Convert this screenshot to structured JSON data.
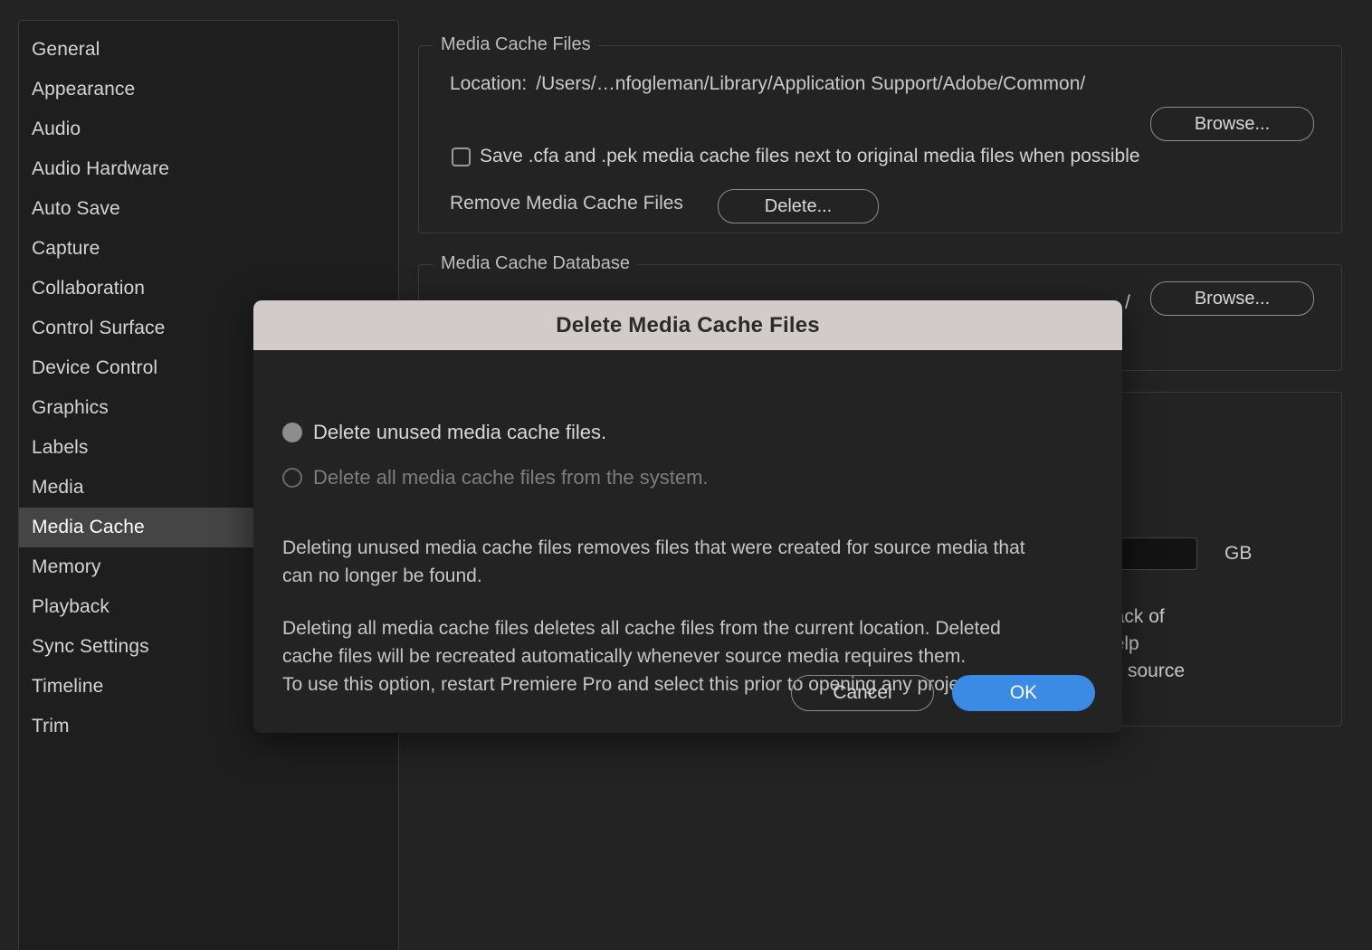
{
  "sidebar": {
    "items": [
      {
        "label": "General",
        "selected": false
      },
      {
        "label": "Appearance",
        "selected": false
      },
      {
        "label": "Audio",
        "selected": false
      },
      {
        "label": "Audio Hardware",
        "selected": false
      },
      {
        "label": "Auto Save",
        "selected": false
      },
      {
        "label": "Capture",
        "selected": false
      },
      {
        "label": "Collaboration",
        "selected": false
      },
      {
        "label": "Control Surface",
        "selected": false
      },
      {
        "label": "Device Control",
        "selected": false
      },
      {
        "label": "Graphics",
        "selected": false
      },
      {
        "label": "Labels",
        "selected": false
      },
      {
        "label": "Media",
        "selected": false
      },
      {
        "label": "Media Cache",
        "selected": true
      },
      {
        "label": "Memory",
        "selected": false
      },
      {
        "label": "Playback",
        "selected": false
      },
      {
        "label": "Sync Settings",
        "selected": false
      },
      {
        "label": "Timeline",
        "selected": false
      },
      {
        "label": "Trim",
        "selected": false
      }
    ]
  },
  "media_cache_files": {
    "group_title": "Media Cache Files",
    "location_label": "Location:",
    "location_path": "/Users/…nfogleman/Library/Application Support/Adobe/Common/",
    "browse_label": "Browse...",
    "save_checkbox_label": "Save .cfa and .pek media cache files next to original media files when possible",
    "save_checkbox_checked": false,
    "remove_label": "Remove Media Cache Files",
    "delete_label": "Delete..."
  },
  "media_cache_database": {
    "group_title": "Media Cache Database",
    "location_path_tail": "/",
    "browse_label": "Browse..."
  },
  "media_cache_management": {
    "size_value": "",
    "unit_label": "GB",
    "note_line_1": "back of",
    "note_line_2": "help",
    "note_line_3": "ver source"
  },
  "dialog": {
    "title": "Delete Media Cache Files",
    "options": [
      {
        "label": "Delete unused media cache files.",
        "selected": true,
        "disabled": false
      },
      {
        "label": "Delete all media cache files from the system.",
        "selected": false,
        "disabled": true
      }
    ],
    "paragraph_1": "Deleting unused media cache files removes files that were created for source media that\ncan no longer be found.",
    "paragraph_2": "Deleting all media cache files deletes all cache files from the current location. Deleted\ncache files will be recreated automatically whenever source media requires them.\nTo use this option, restart Premiere Pro and select this prior to opening any project.",
    "cancel_label": "Cancel",
    "ok_label": "OK"
  },
  "colors": {
    "background": "#232323",
    "sidebar": "#1e1e1e",
    "selected_row": "#454545",
    "dialog_titlebar": "#d2cbcb",
    "accent_blue": "#3b8ae4",
    "border": "#3a3a3a",
    "text": "#d2d2d2",
    "text_disabled": "#7d7d7d"
  }
}
